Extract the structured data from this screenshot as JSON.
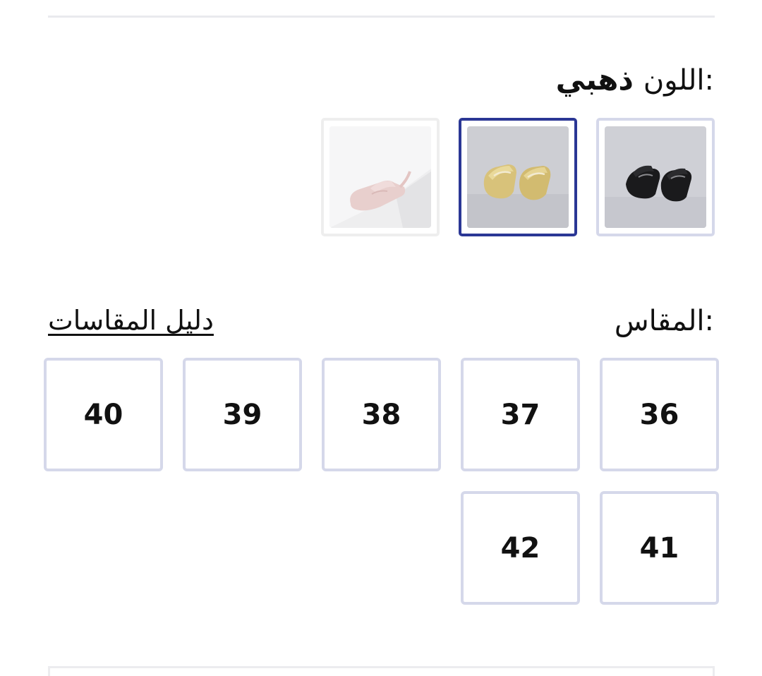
{
  "color": {
    "label": "اللون:",
    "selected_value": "ذهبي",
    "swatches": [
      {
        "name": "black-slipper",
        "selected": false
      },
      {
        "name": "gold-slipper",
        "selected": true
      },
      {
        "name": "pink-slipper",
        "selected": false
      }
    ]
  },
  "size": {
    "label": "المقاس:",
    "guide_link": "دليل المقاسات",
    "options": [
      "36",
      "37",
      "38",
      "39",
      "40",
      "41",
      "42"
    ]
  },
  "colors": {
    "selected_border": "#2b3795",
    "default_border": "#d5d8ea"
  }
}
